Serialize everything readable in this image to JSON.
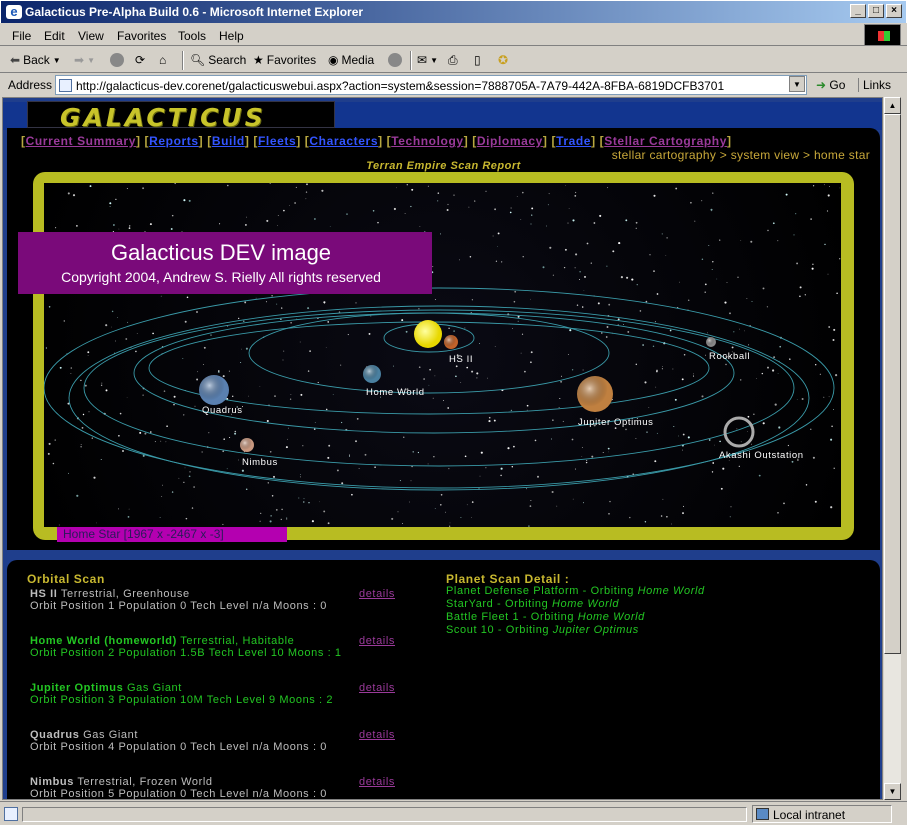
{
  "window": {
    "title": "Galacticus Pre-Alpha Build 0.6 - Microsoft Internet Explorer"
  },
  "menu": [
    "File",
    "Edit",
    "View",
    "Favorites",
    "Tools",
    "Help"
  ],
  "toolbar": {
    "back": "Back",
    "search": "Search",
    "favorites": "Favorites",
    "media": "Media"
  },
  "address": {
    "label": "Address",
    "url": "http://galacticus-dev.corenet/galacticuswebui.aspx?action=system&session=7888705A-7A79-442A-8FBA-6819DCFB3701",
    "go": "Go",
    "links": "Links"
  },
  "status": {
    "zone": "Local intranet"
  },
  "site": {
    "logo": "GALACTICUS",
    "nav": [
      "Current Summary",
      "Reports",
      "Build",
      "Fleets",
      "Characters",
      "Technology",
      "Diplomacy",
      "Trade",
      "Stellar Cartography"
    ],
    "breadcrumb": "stellar cartography > system view > home star",
    "scan_title": "Terran Empire Scan Report",
    "watermark_title": "Galacticus DEV image",
    "watermark_copy": "Copyright 2004, Andrew S. Rielly All rights reserved",
    "location": "Home Star [1967 x -2467 x -3]",
    "bodies": [
      {
        "label": "HS II",
        "color": "#c0622a"
      },
      {
        "label": "Home World",
        "color": "#4a80a0"
      },
      {
        "label": "Quadrus",
        "color": "#5a80b0"
      },
      {
        "label": "Nimbus",
        "color": "#c89880"
      },
      {
        "label": "Rockball",
        "color": "#888888"
      },
      {
        "label": "Jupiter Optimus",
        "color": "#c08040"
      },
      {
        "label": "Akashi Outstation",
        "color": "#aaaaaa"
      }
    ]
  },
  "orbital": {
    "heading": "Orbital Scan",
    "details_label": "details",
    "items": [
      {
        "name": "HS II",
        "type": "Terrestrial, Greenhouse",
        "info": "Orbit Position 1 Population 0 Tech Level n/a Moons : 0"
      },
      {
        "name": "Home World (homeworld)",
        "type": "Terrestrial, Habitable",
        "info": "Orbit Position 2 Population 1.5B Tech Level 10 Moons : 1"
      },
      {
        "name": "Jupiter Optimus",
        "type": "Gas Giant",
        "info": "Orbit Position 3 Population 10M Tech Level 9 Moons : 2"
      },
      {
        "name": "Quadrus",
        "type": "Gas Giant",
        "info": "Orbit Position 4 Population 0 Tech Level n/a Moons : 0"
      },
      {
        "name": "Nimbus",
        "type": "Terrestrial, Frozen World",
        "info": "Orbit Position 5 Population 0 Tech Level n/a Moons : 0"
      }
    ]
  },
  "planet_detail": {
    "heading": "Planet Scan Detail :",
    "items": [
      {
        "name": "Planet Defense Platform",
        "sep": " - Orbiting ",
        "target": "Home World"
      },
      {
        "name": "StarYard",
        "sep": " - Orbiting ",
        "target": "Home World"
      },
      {
        "name": "Battle Fleet 1",
        "sep": " - Orbiting ",
        "target": "Home World"
      },
      {
        "name": "Scout 10",
        "sep": " - Orbiting ",
        "target": "Jupiter Optimus"
      }
    ]
  }
}
